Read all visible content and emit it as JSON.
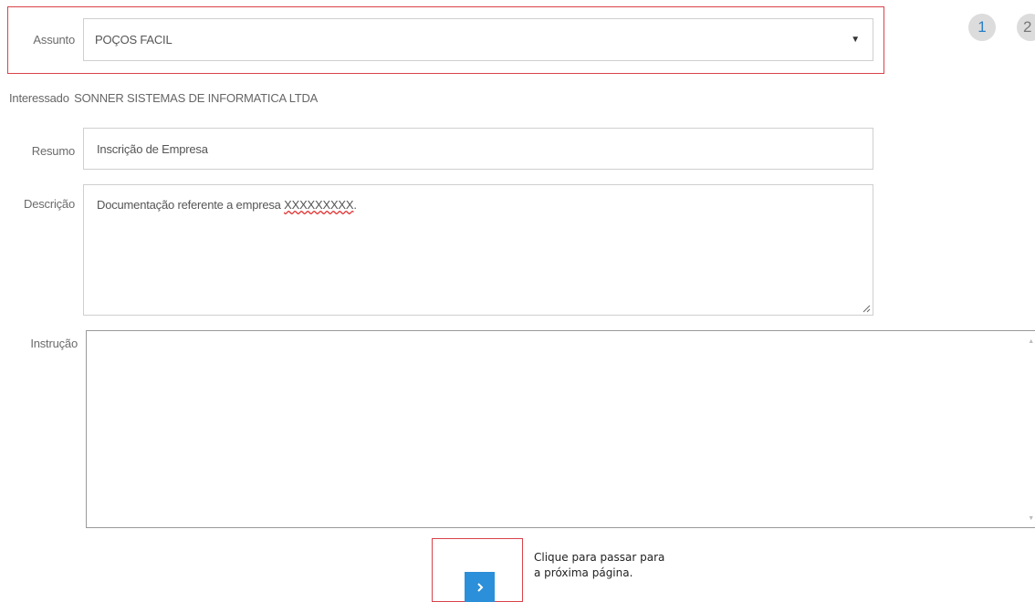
{
  "form": {
    "assunto": {
      "label": "Assunto",
      "value": "POÇOS FACIL"
    },
    "interessado": {
      "label": "Interessado",
      "value": "SONNER SISTEMAS DE INFORMATICA LTDA"
    },
    "resumo": {
      "label": "Resumo",
      "value": "Inscrição de Empresa"
    },
    "descricao": {
      "label": "Descrição",
      "value_prefix": "Documentação referente a empresa ",
      "value_misspelled": "XXXXXXXXX",
      "value_suffix": "."
    },
    "instrucao": {
      "label": "Instrução",
      "value": ""
    }
  },
  "steps": {
    "current": "1",
    "next": "2"
  },
  "navigation": {
    "next_icon": "chevron-right-icon",
    "hint_line1": "Clique para passar para",
    "hint_line2": "a próxima página."
  },
  "colors": {
    "highlight": "#d9424a",
    "primary_button": "#2b8fd9",
    "step_active_text": "#2a7fc7"
  }
}
